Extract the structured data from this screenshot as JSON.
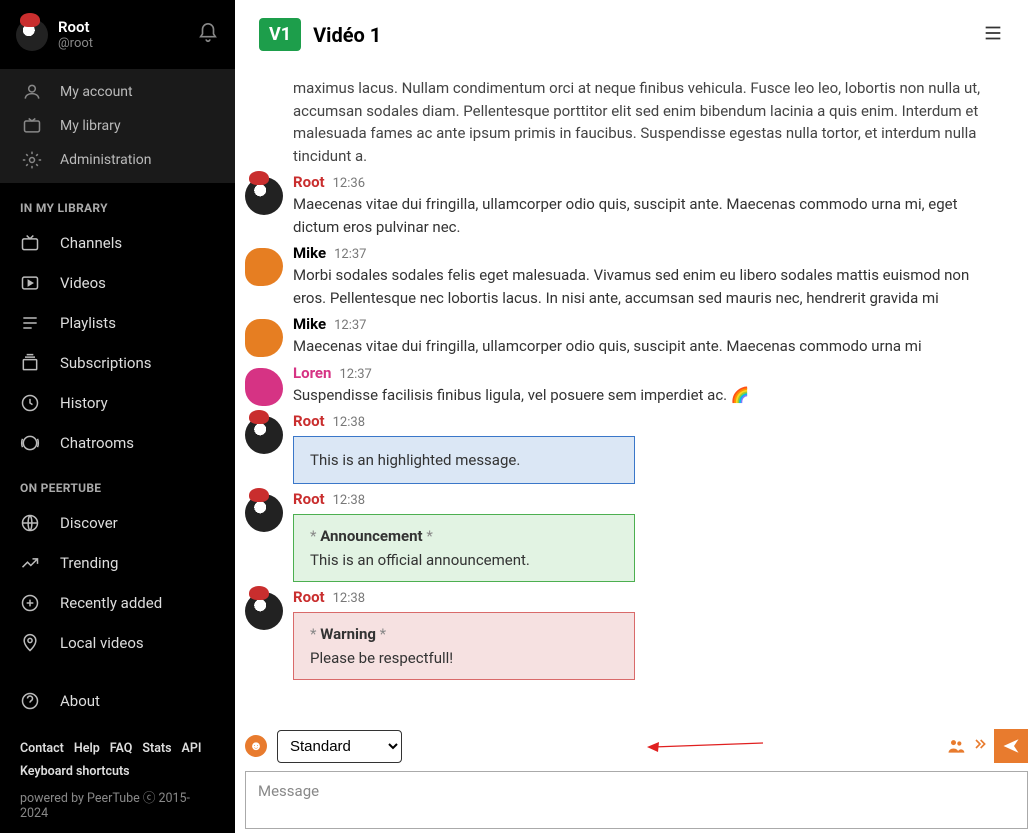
{
  "user": {
    "name": "Root",
    "handle": "@root"
  },
  "account_menu": {
    "my_account": "My account",
    "my_library": "My library",
    "administration": "Administration"
  },
  "sections": {
    "library": "IN MY LIBRARY",
    "peertube": "ON PEERTUBE"
  },
  "library_nav": {
    "channels": "Channels",
    "videos": "Videos",
    "playlists": "Playlists",
    "subscriptions": "Subscriptions",
    "history": "History",
    "chatrooms": "Chatrooms"
  },
  "peertube_nav": {
    "discover": "Discover",
    "trending": "Trending",
    "recently_added": "Recently added",
    "local_videos": "Local videos",
    "about": "About"
  },
  "footer": {
    "links": [
      "Contact",
      "Help",
      "FAQ",
      "Stats",
      "API"
    ],
    "kbd": "Keyboard shortcuts",
    "powered": "powered by PeerTube ⓒ 2015-2024"
  },
  "header": {
    "badge": "V1",
    "title": "Vidéo 1"
  },
  "messages": [
    {
      "author": "",
      "time": "",
      "avatar": "none",
      "truncated": true,
      "author_class": "",
      "text": "maximus lacus. Nullam condimentum orci at neque finibus vehicula. Fusce leo leo, lobortis non nulla ut, accumsan sodales diam. Pellentesque porttitor elit sed enim bibendum lacinia a quis enim. Interdum et malesuada fames ac ante ipsum primis in faucibus. Suspendisse egestas nulla tortor, et interdum nulla tincidunt a."
    },
    {
      "author": "Root",
      "author_class": "root",
      "time": "12:36",
      "avatar": "root",
      "text": "Maecenas vitae dui fringilla, ullamcorper odio quis, suscipit ante. Maecenas commodo urna mi, eget dictum eros pulvinar nec."
    },
    {
      "author": "Mike",
      "author_class": "",
      "time": "12:37",
      "avatar": "mike",
      "text": "Morbi sodales sodales felis eget malesuada. Vivamus sed enim eu libero sodales mattis euismod non eros. Pellentesque nec lobortis lacus. In nisi ante, accumsan sed mauris nec, hendrerit gravida mi"
    },
    {
      "author": "Mike",
      "author_class": "",
      "time": "12:37",
      "avatar": "mike",
      "text": "Maecenas vitae dui fringilla, ullamcorper odio quis, suscipit ante. Maecenas commodo urna mi"
    },
    {
      "author": "Loren",
      "author_class": "loren",
      "time": "12:37",
      "avatar": "loren",
      "text": "Suspendisse facilisis finibus ligula, vel posuere sem imperdiet ac. 🌈"
    },
    {
      "author": "Root",
      "author_class": "root",
      "time": "12:38",
      "avatar": "root",
      "box": "highlight",
      "box_text": "This is an highlighted message."
    },
    {
      "author": "Root",
      "author_class": "root",
      "time": "12:38",
      "avatar": "root",
      "box": "announce",
      "box_label": "Announcement",
      "box_text": "This is an official announcement."
    },
    {
      "author": "Root",
      "author_class": "root",
      "time": "12:38",
      "avatar": "root",
      "box": "warn",
      "box_label": "Warning",
      "box_text": "Please be respectfull!"
    }
  ],
  "compose": {
    "style_selected": "Standard",
    "placeholder": "Message"
  },
  "colors": {
    "accent": "#e87b2e",
    "root_name": "#c92e2e",
    "loren_name": "#d63384",
    "badge_green": "#1d9e4b"
  }
}
